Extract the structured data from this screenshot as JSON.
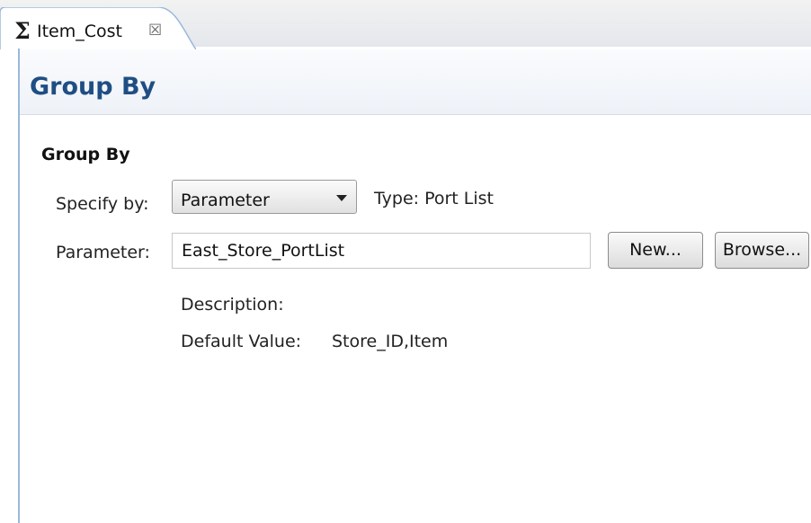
{
  "tab": {
    "icon": "sigma-icon",
    "icon_glyph": "Σ",
    "label": "Item_Cost",
    "close_glyph": "☒"
  },
  "header": {
    "title": "Group By"
  },
  "section": {
    "title": "Group By",
    "specify_by_label": "Specify by:",
    "specify_by_value": "Parameter",
    "type_text": "Type: Port List",
    "parameter_label": "Parameter:",
    "parameter_value": "East_Store_PortList",
    "new_button": "New...",
    "browse_button": "Browse...",
    "description_label": "Description:",
    "default_value_label": "Default Value:",
    "default_value": "Store_ID,Item"
  },
  "colors": {
    "title_blue": "#1f4e83",
    "border_blue": "#9ab8da"
  }
}
